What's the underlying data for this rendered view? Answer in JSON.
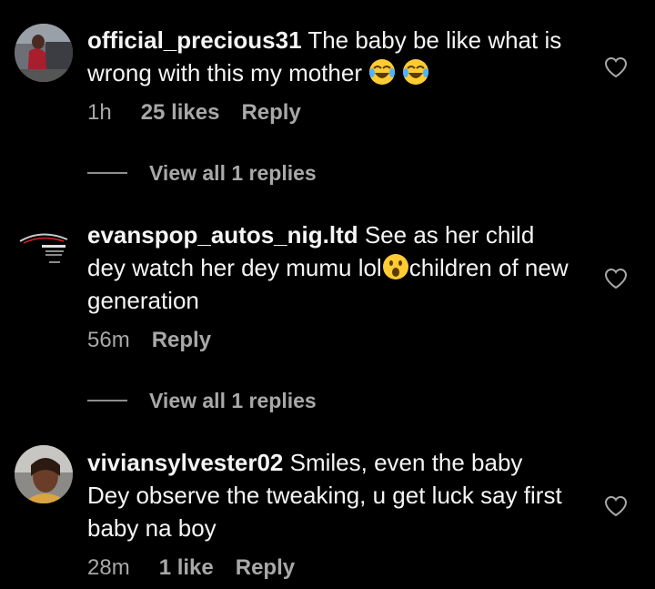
{
  "comments": [
    {
      "username": "official_precious31",
      "text": "The baby be like what is wrong with this my mother",
      "emoji": "😂😂",
      "time": "1h",
      "likes": "25 likes",
      "reply": "Reply",
      "view_replies": "View all 1 replies"
    },
    {
      "username": "evanspop_autos_nig.ltd",
      "text_part1": "See as her child dey watch her dey mumu lol",
      "emoji": "😮",
      "text_part2": "children of new generation",
      "time": "56m",
      "reply": "Reply",
      "view_replies": "View all 1 replies"
    },
    {
      "username": "viviansylvester02",
      "text": "Smiles, even the baby Dey observe the tweaking, u get luck say first baby na boy",
      "time": "28m",
      "likes": "1 like",
      "reply": "Reply"
    }
  ],
  "icons": {
    "like": "heart-outline-icon"
  }
}
